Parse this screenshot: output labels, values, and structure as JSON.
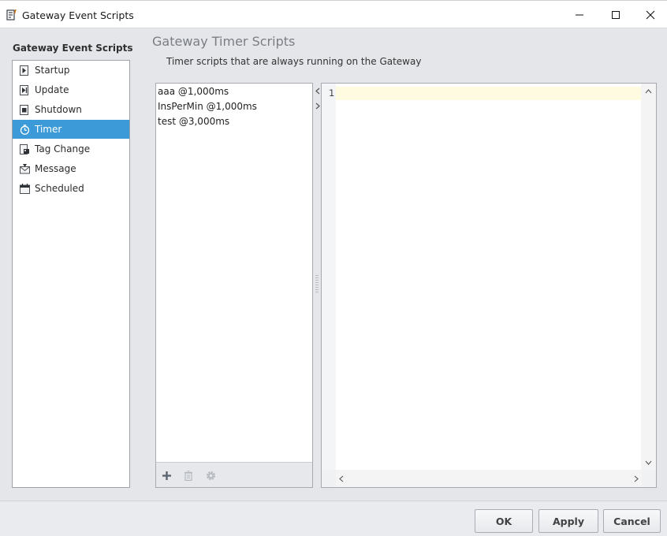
{
  "window": {
    "title": "Gateway Event Scripts",
    "icon": "script-document-icon"
  },
  "sidebar": {
    "heading": "Gateway Event Scripts",
    "items": [
      {
        "label": "Startup",
        "icon": "startup-script-icon",
        "selected": false
      },
      {
        "label": "Update",
        "icon": "update-script-icon",
        "selected": false
      },
      {
        "label": "Shutdown",
        "icon": "shutdown-script-icon",
        "selected": false
      },
      {
        "label": "Timer",
        "icon": "stopwatch-icon",
        "selected": true
      },
      {
        "label": "Tag Change",
        "icon": "tag-change-icon",
        "selected": false
      },
      {
        "label": "Message",
        "icon": "message-icon",
        "selected": false
      },
      {
        "label": "Scheduled",
        "icon": "calendar-icon",
        "selected": false
      }
    ]
  },
  "main": {
    "heading": "Gateway Timer Scripts",
    "description": "Timer scripts that are always running on the Gateway",
    "scripts": [
      "aaa @1,000ms",
      "InsPerMin @1,000ms",
      "test @3,000ms"
    ],
    "toolbar": [
      "add-icon",
      "delete-icon",
      "settings-icon"
    ]
  },
  "editor": {
    "line_numbers": [
      "1"
    ],
    "content": ""
  },
  "footer": {
    "ok_label": "OK",
    "apply_label": "Apply",
    "cancel_label": "Cancel"
  },
  "colors": {
    "selection": "#3c9ad8",
    "panel": "#e4e6e9",
    "current_line": "#fffbe1",
    "add_icon": "#5c6570"
  }
}
